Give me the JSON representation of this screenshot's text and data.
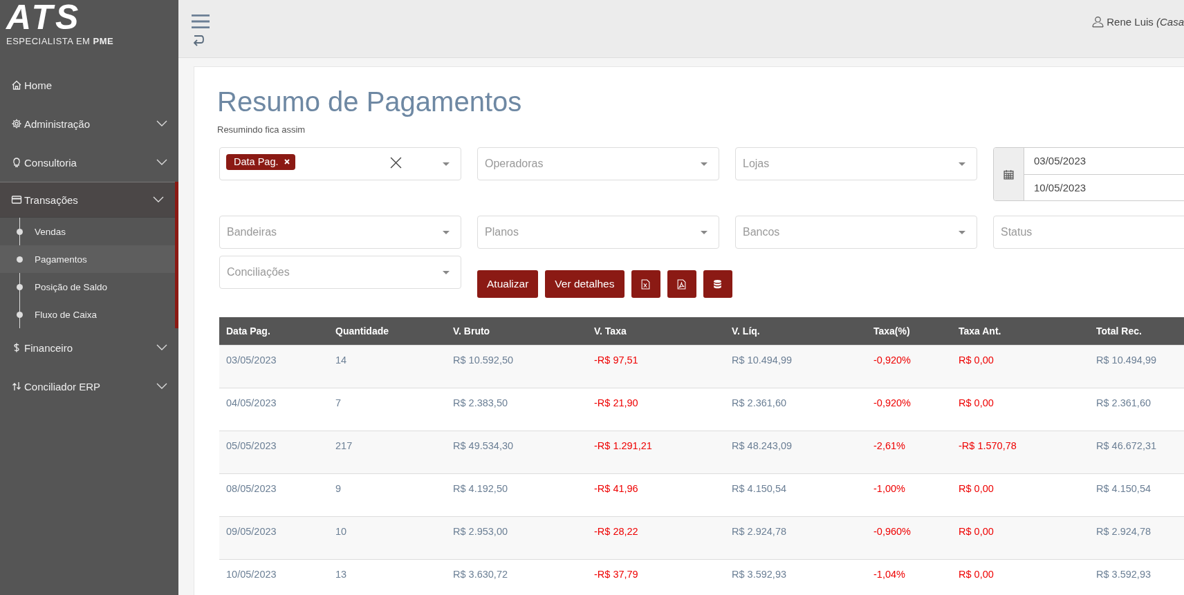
{
  "logo": {
    "mark": "ATS",
    "tagline": "ESPECIALISTA EM **PME**"
  },
  "sidebar": {
    "items": [
      {
        "label": "Home",
        "kind": "home",
        "has_submenu": false,
        "selected": false
      },
      {
        "label": "Administração",
        "kind": "gear",
        "has_submenu": true,
        "selected": false
      },
      {
        "label": "Consultoria",
        "kind": "bulb",
        "has_submenu": true,
        "selected": false
      },
      {
        "label": "Transações",
        "kind": "card",
        "has_submenu": true,
        "expanded": true,
        "selected": true,
        "children": [
          {
            "label": "Vendas",
            "selected": false
          },
          {
            "label": "Pagamentos",
            "selected": true
          },
          {
            "label": "Posição de Saldo",
            "selected": false
          },
          {
            "label": "Fluxo de Caixa",
            "selected": false
          }
        ]
      },
      {
        "label": "Financeiro",
        "kind": "dollar",
        "has_submenu": true,
        "selected": false
      },
      {
        "label": "Conciliador ERP",
        "kind": "swap",
        "has_submenu": true,
        "selected": false
      }
    ]
  },
  "topbar": {
    "user": "Rene Luis *(Casa*"
  },
  "page": {
    "title": "Resumo de Pagamentos",
    "subtitle": "Resumindo fica assim"
  },
  "filters": {
    "group_by": {
      "tag": "Data Pag."
    },
    "selects": [
      {
        "placeholder": "Operadoras"
      },
      {
        "placeholder": "Lojas"
      }
    ],
    "date_from": "03/05/2023",
    "date_to": "10/05/2023",
    "selects2": [
      {
        "placeholder": "Bandeiras"
      },
      {
        "placeholder": "Planos"
      },
      {
        "placeholder": "Bancos"
      }
    ],
    "status": {
      "placeholder": "Status"
    },
    "conciliacoes": {
      "placeholder": "Conciliações"
    }
  },
  "actions": [
    {
      "kind": "text",
      "label": "Atualizar"
    },
    {
      "kind": "text",
      "label": "Ver detalhes"
    },
    {
      "kind": "excel"
    },
    {
      "kind": "pdf"
    },
    {
      "kind": "database"
    }
  ],
  "table": {
    "columns": [
      {
        "label": "Data Pag.",
        "kind": "plain"
      },
      {
        "label": "Quantidade",
        "kind": "plain"
      },
      {
        "label": "V. Bruto",
        "kind": "plain"
      },
      {
        "label": "V. Taxa",
        "kind": "negative"
      },
      {
        "label": "V. Líq.",
        "kind": "plain"
      },
      {
        "label": "Taxa(%)",
        "kind": "negative"
      },
      {
        "label": "Taxa Ant.",
        "kind": "negative"
      },
      {
        "label": "Total Rec.",
        "kind": "plain"
      }
    ],
    "rows": [
      [
        "03/05/2023",
        "14",
        "R$ 10.592,50",
        "-R$ 97,51",
        "R$ 10.494,99",
        "-0,920%",
        "R$ 0,00",
        "R$ 10.494,99"
      ],
      [
        "04/05/2023",
        "7",
        "R$ 2.383,50",
        "-R$ 21,90",
        "R$ 2.361,60",
        "-0,920%",
        "R$ 0,00",
        "R$ 2.361,60"
      ],
      [
        "05/05/2023",
        "217",
        "R$ 49.534,30",
        "-R$ 1.291,21",
        "R$ 48.243,09",
        "-2,61%",
        "-R$ 1.570,78",
        "R$ 46.672,31"
      ],
      [
        "08/05/2023",
        "9",
        "R$ 4.192,50",
        "-R$ 41,96",
        "R$ 4.150,54",
        "-1,00%",
        "R$ 0,00",
        "R$ 4.150,54"
      ],
      [
        "09/05/2023",
        "10",
        "R$ 2.953,00",
        "-R$ 28,22",
        "R$ 2.924,78",
        "-0,960%",
        "R$ 0,00",
        "R$ 2.924,78"
      ],
      [
        "10/05/2023",
        "13",
        "R$ 3.630,72",
        "-R$ 37,79",
        "R$ 3.592,93",
        "-1,04%",
        "R$ 0,00",
        "R$ 3.592,93"
      ]
    ]
  }
}
